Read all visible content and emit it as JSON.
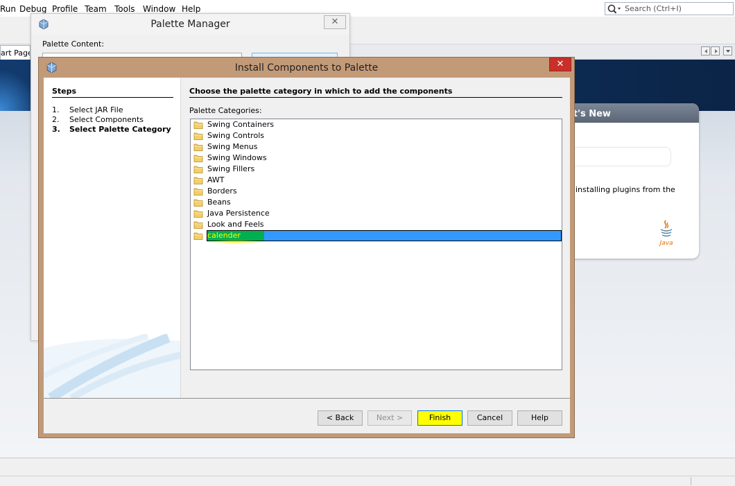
{
  "ide": {
    "menu": [
      "Run",
      "Debug",
      "Profile",
      "Team",
      "Tools",
      "Window",
      "Help"
    ],
    "search_placeholder": "Search (Ctrl+I)",
    "start_tab_label": "art Page",
    "whats_new_title": "at's New",
    "whats_new_text": "installing plugins from the",
    "java_logo_text": "Java"
  },
  "palette_manager": {
    "title": "Palette Manager",
    "close_glyph": "✕",
    "content_label": "Palette Content:"
  },
  "dialog": {
    "title": "Install Components to Palette",
    "close_glyph": "✕",
    "steps_title": "Steps",
    "steps": [
      {
        "num": "1.",
        "label": "Select JAR File"
      },
      {
        "num": "2.",
        "label": "Select Components"
      },
      {
        "num": "3.",
        "label": "Select Palette Category"
      }
    ],
    "heading": "Choose the palette category in which to add the components",
    "categories_label": "Palette Categories:",
    "categories": [
      "Swing Containers",
      "Swing Controls",
      "Swing Menus",
      "Swing Windows",
      "Swing Fillers",
      "AWT",
      "Borders",
      "Beans",
      "Java Persistence",
      "Look and Feels",
      "calender"
    ],
    "selected_category": "calender",
    "buttons": {
      "back": "< Back",
      "next": "Next >",
      "finish": "Finish",
      "cancel": "Cancel",
      "help": "Help"
    }
  }
}
